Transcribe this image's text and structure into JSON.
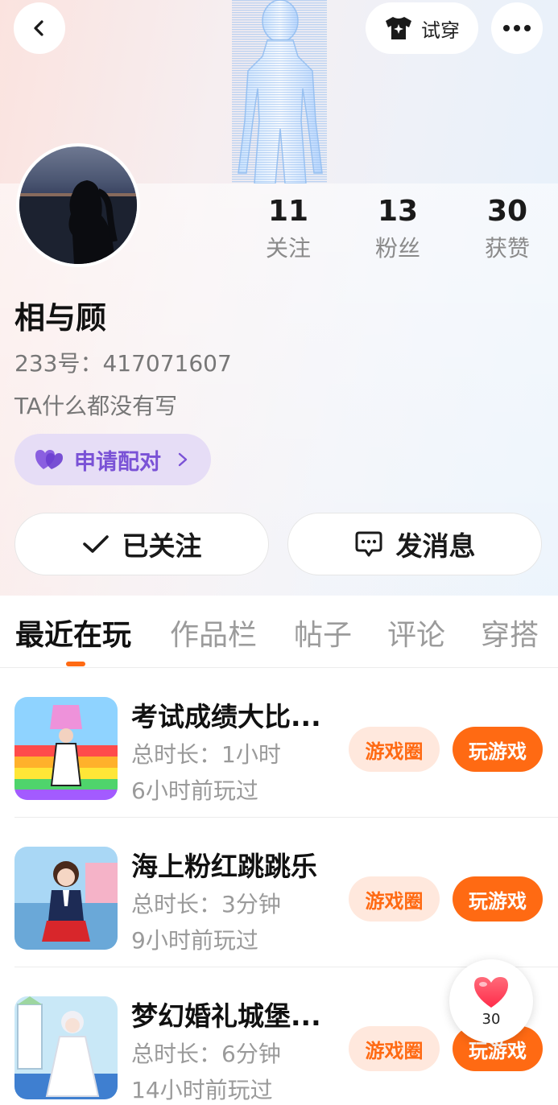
{
  "header": {
    "tryon_label": "试穿"
  },
  "profile": {
    "name": "相与顾",
    "uid": "233号：417071607",
    "bio": "TA什么都没有写",
    "pair_label": "申请配对",
    "stats": [
      {
        "num": "11",
        "label": "关注"
      },
      {
        "num": "13",
        "label": "粉丝"
      },
      {
        "num": "30",
        "label": "获赞"
      }
    ],
    "follow_label": "已关注",
    "message_label": "发消息"
  },
  "tabs": [
    "最近在玩",
    "作品栏",
    "帖子",
    "评论",
    "穿搭"
  ],
  "games": [
    {
      "title": "考试成绩大比...",
      "duration": "总时长：1小时",
      "last_played": "6小时前玩过",
      "circle_label": "游戏圈",
      "play_label": "玩游戏"
    },
    {
      "title": "海上粉红跳跳乐",
      "duration": "总时长：3分钟",
      "last_played": "9小时前玩过",
      "circle_label": "游戏圈",
      "play_label": "玩游戏"
    },
    {
      "title": "梦幻婚礼城堡...",
      "duration": "总时长：6分钟",
      "last_played": "14小时前玩过",
      "circle_label": "游戏圈",
      "play_label": "玩游戏"
    }
  ],
  "like_float": {
    "count": "30"
  },
  "colors": {
    "accent": "#ff6a13",
    "accent_soft": "#ffe8dd",
    "pair_bg": "#e6ddf6",
    "pair_text": "#7a52d6"
  }
}
